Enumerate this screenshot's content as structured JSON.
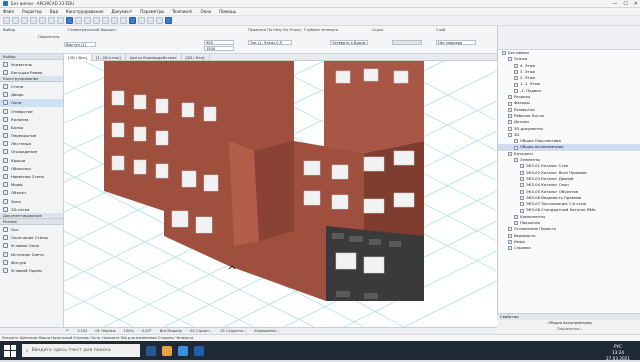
{
  "window": {
    "title": "Без имени - ARCHICAD 23 EDU",
    "controls": [
      "—",
      "☐",
      "✕"
    ]
  },
  "menu": [
    "Файл",
    "Редактор",
    "Вид",
    "Конструирование",
    "Документ",
    "Параметры",
    "Teamwork",
    "Окно",
    "Помощь"
  ],
  "infobox": {
    "section1_label": "Выбор",
    "section2_label": "Параметры",
    "geometry_label": "Геометрический Вариант",
    "field_value": "Выступ (1)",
    "width": "900",
    "height": "1500",
    "ref_label": "Привязка По Низу Ко Этажу",
    "ref_value": "Тек.(1. Этаж) 0,9",
    "sill_label": "Глубина четверти",
    "sill_value": "Четверть к Вдоль",
    "hide_label": "Скрыт",
    "layer_label": "Слой",
    "layer_value": "Нет маркера"
  },
  "tabs": {
    "t1": "[3D / Все]",
    "t2": "[1. 2D-этаж]",
    "t3": "Центр Взаимодействия",
    "t4": "[3D / Все]"
  },
  "toolbox": {
    "header1": "Выбор",
    "tool_select": "Указатель",
    "tool_marquee": "Бегущая Рамка",
    "header2": "Конструирование",
    "tools": [
      "Стена",
      "Дверь",
      "Окно",
      "Отверстие",
      "Колонна",
      "Балка",
      "Перекрытие",
      "Лестница",
      "Ограждение",
      "Крыша",
      "Оболочка",
      "Навесная Стена",
      "Морф",
      "Объект",
      "Зона",
      "3D-сетка"
    ],
    "selected": "Окно",
    "header3": "Документирование",
    "header4": "Разное",
    "misc": [
      "Ось",
      "Окончание Стены",
      "Угловое Окно",
      "Источник Света",
      "Фигура",
      "Угловой Проем"
    ]
  },
  "navigator": {
    "items": [
      {
        "label": "Без имени",
        "level": 0
      },
      {
        "label": "Этажи",
        "level": 1
      },
      {
        "label": "4. Этаж",
        "level": 2
      },
      {
        "label": "3. Этаж",
        "level": 2
      },
      {
        "label": "2. Этаж",
        "level": 2
      },
      {
        "label": "1. 1. Этаж",
        "level": 2
      },
      {
        "label": "-1. Подвал",
        "level": 2
      },
      {
        "label": "Разрезы",
        "level": 1
      },
      {
        "label": "Фасады",
        "level": 1
      },
      {
        "label": "Развертки",
        "level": 1
      },
      {
        "label": "Рабочие Листы",
        "level": 1
      },
      {
        "label": "Детали",
        "level": 1
      },
      {
        "label": "3D-документы",
        "level": 1
      },
      {
        "label": "3D",
        "level": 1
      },
      {
        "label": "Общая Перспектива",
        "level": 2
      },
      {
        "label": "Общая Аксонометрия",
        "level": 2
      },
      {
        "label": "Каталоги",
        "level": 1
      },
      {
        "label": "Элементы",
        "level": 2
      },
      {
        "label": "ЭКЗ-01 Каталог Стен",
        "level": 3
      },
      {
        "label": "ЭКЗ-02 Каталог Всех Проемов",
        "level": 3
      },
      {
        "label": "ЭКЗ-03 Каталог Дверей",
        "level": 3
      },
      {
        "label": "ЭКЗ-04 Каталог Окон",
        "level": 3
      },
      {
        "label": "ЭКЗ-05 Каталог Объектов",
        "level": 3
      },
      {
        "label": "ЭКЗ-06 Ведомость Проемов",
        "level": 3
      },
      {
        "label": "ЭКЗ-07 Экспликация 1-й этаж",
        "level": 3
      },
      {
        "label": "ЭКЗ-08 Стандартный Каталог ВМи",
        "level": 3
      },
      {
        "label": "Компоненты",
        "level": 2
      },
      {
        "label": "Покрытия",
        "level": 2
      },
      {
        "label": "Оглавление Проекта",
        "level": 1
      },
      {
        "label": "Ведомость",
        "level": 1
      },
      {
        "label": "Инфо",
        "level": 1
      },
      {
        "label": "Справка",
        "level": 1
      }
    ],
    "selected": "Общая Аксонометрия"
  },
  "properties": {
    "header": "Свойства",
    "row1": "Общая Аксонометрия",
    "row2": "Параметры..."
  },
  "status": {
    "undo": "↶",
    "zoom": "1:100",
    "layer": "01 Чертеж",
    "scale": "100%",
    "angle": "0,00°",
    "model": "Вся Модель",
    "struct": "03 Строит...",
    "renov": "01 Существ...",
    "pen": "Упрощенны..."
  },
  "hint": "Укажите Щелчком Мыши Начальный Отрезок Окна. Нажмите Tab для изменения Стороны Четверти.",
  "taskbar": {
    "search": "Введите здесь текст для поиска",
    "time": "13:24",
    "date": "27.03.2021",
    "lang": "РУС"
  },
  "colors": {
    "brick": "#9e4f3e",
    "accent": "#3b7bd0",
    "grid": "#6cc9d8"
  }
}
